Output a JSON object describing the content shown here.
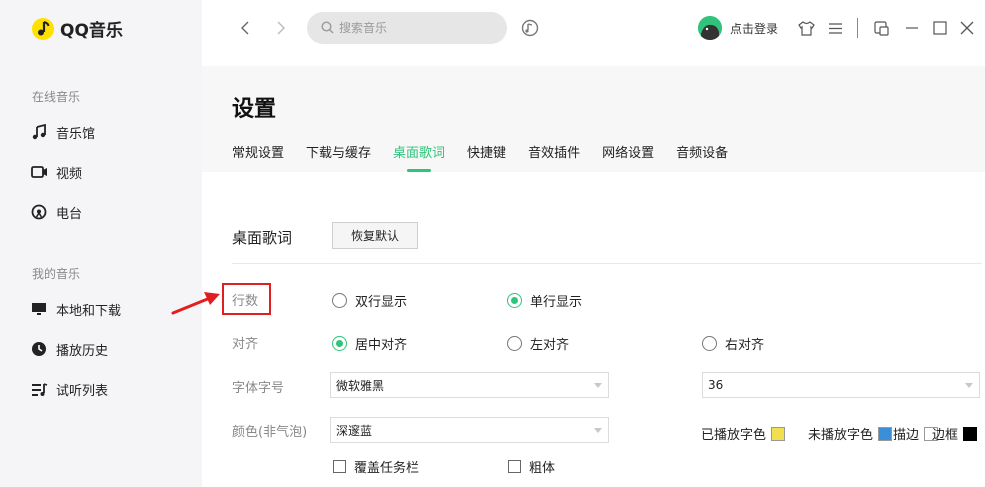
{
  "app": {
    "name": "QQ音乐"
  },
  "sidebar": {
    "online_title": "在线音乐",
    "mine_title": "我的音乐",
    "items": [
      {
        "label": "音乐馆",
        "icon": "music-note-icon"
      },
      {
        "label": "视频",
        "icon": "video-icon"
      },
      {
        "label": "电台",
        "icon": "radio-icon"
      },
      {
        "label": "本地和下载",
        "icon": "monitor-icon"
      },
      {
        "label": "播放历史",
        "icon": "history-clock-icon"
      },
      {
        "label": "试听列表",
        "icon": "playlist-icon"
      }
    ]
  },
  "topbar": {
    "search_placeholder": "搜索音乐",
    "login_text": "点击登录",
    "icons": [
      "back-arrow-icon",
      "forward-arrow-icon",
      "search-icon",
      "listen-identify-icon",
      "skin-shirt-icon",
      "menu-icon",
      "mini-mode-icon",
      "minimize-icon",
      "maximize-icon",
      "close-icon"
    ]
  },
  "settings": {
    "title": "设置",
    "tabs": [
      "常规设置",
      "下载与缓存",
      "桌面歌词",
      "快捷键",
      "音效插件",
      "网络设置",
      "音频设备"
    ],
    "active_tab": "桌面歌词",
    "section_title": "桌面歌词",
    "restore_label": "恢复默认",
    "rows": {
      "lines_label": "行数",
      "lines_options": [
        "双行显示",
        "单行显示"
      ],
      "lines_selected": "单行显示",
      "align_label": "对齐",
      "align_options": [
        "居中对齐",
        "左对齐",
        "右对齐"
      ],
      "align_selected": "居中对齐",
      "font_label": "字体字号",
      "font_value": "微软雅黑",
      "size_value": "36",
      "color_label": "颜色(非气泡)",
      "color_value": "深邃蓝",
      "played_color_label": "已播放字色",
      "unplayed_color_label": "未播放字色",
      "stroke_label": "描边",
      "border_label": "边框",
      "played_color": "#f0e050",
      "unplayed_color": "#3a8fd8",
      "stroke_color": "#ffffff",
      "border_color": "#000000",
      "cover_taskbar_label": "覆盖任务栏",
      "bold_label": "粗体"
    }
  },
  "accent_color": "#31c27c"
}
